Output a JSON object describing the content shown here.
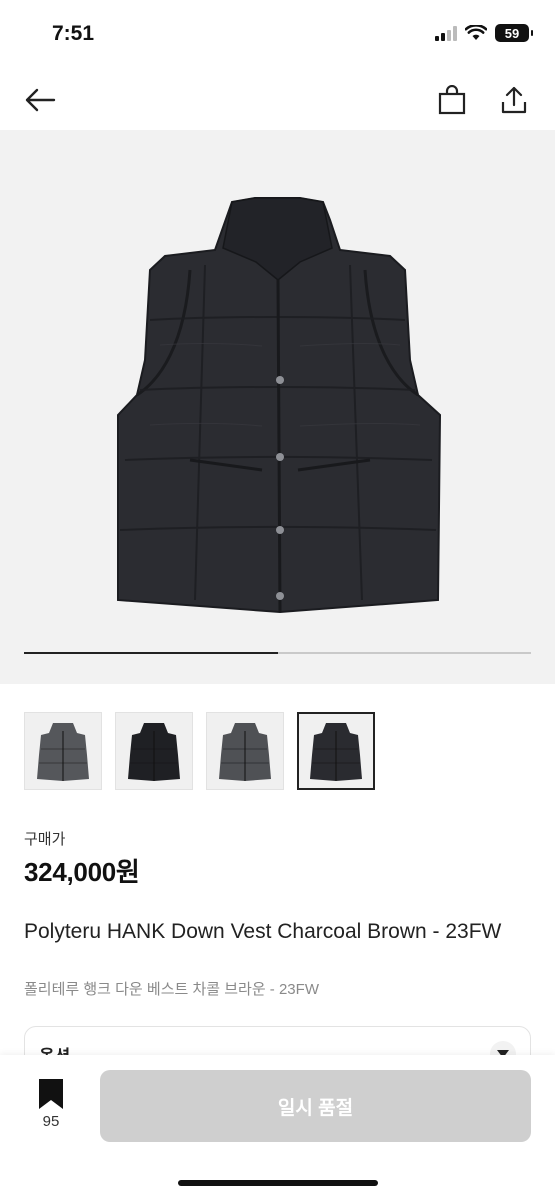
{
  "status_bar": {
    "time": "7:51",
    "battery": "59"
  },
  "nav": {
    "back_icon": "arrow-left-icon",
    "bag_icon": "shopping-bag-icon",
    "share_icon": "share-icon"
  },
  "gallery": {
    "images": 4,
    "selected_index": 3,
    "progress_fraction": 0.5,
    "thumbnails": [
      {
        "name": "vest-gray"
      },
      {
        "name": "vest-black"
      },
      {
        "name": "vest-gray-2"
      },
      {
        "name": "vest-charcoal"
      }
    ]
  },
  "product": {
    "price_label": "구매가",
    "price": "324,000원",
    "title_en": "Polyteru HANK Down Vest Charcoal Brown - 23FW",
    "title_ko": "폴리테루 행크 다운 베스트 차콜 브라운 - 23FW"
  },
  "option": {
    "label": "옵션"
  },
  "bottom": {
    "bookmark_count": "95",
    "cta_label": "일시 품절"
  },
  "colors": {
    "cta_disabled": "#cfcfcf",
    "hero_bg": "#f2f2f2",
    "vest": "#2b2c31"
  }
}
